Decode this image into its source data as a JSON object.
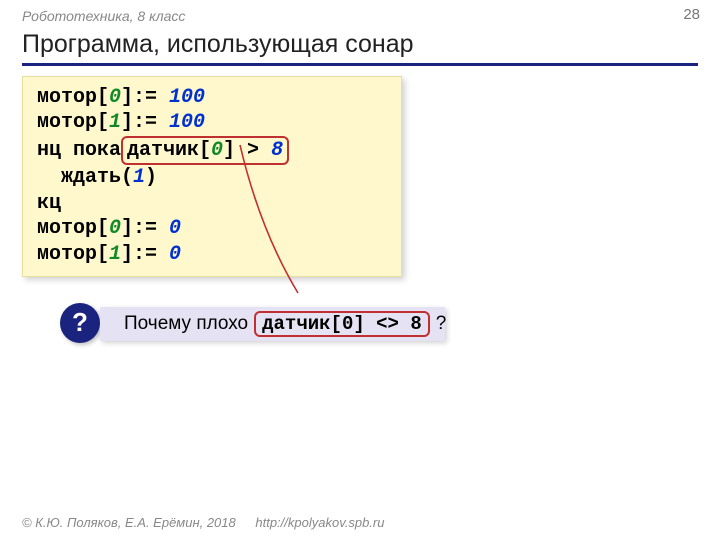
{
  "header": {
    "course": "Робототехника, 8 класс",
    "page": "28",
    "title": "Программа, использующая сонар"
  },
  "code": {
    "l1_a": "мотор[",
    "l1_idx": "0",
    "l1_b": "]:= ",
    "l1_val": "100",
    "l2_a": "мотор[",
    "l2_idx": "1",
    "l2_b": "]:= ",
    "l2_val": "100",
    "l3_a": "нц пока",
    "l3_hl_a": " датчик[",
    "l3_hl_idx": "0",
    "l3_hl_b": "] > ",
    "l3_hl_val": "8",
    "l3_hl_sp": " ",
    "l4_a": "  ждать(",
    "l4_val": "1",
    "l4_b": ")",
    "l5": "кц",
    "l6_a": "мотор[",
    "l6_idx": "0",
    "l6_b": "]:= ",
    "l6_val": "0",
    "l7_a": "мотор[",
    "l7_idx": "1",
    "l7_b": "]:= ",
    "l7_val": "0"
  },
  "question": {
    "mark": "?",
    "prefix": "Почему плохо",
    "hl": "датчик[0] <> 8",
    "suffix": "?"
  },
  "footer": {
    "copyright": "© К.Ю. Поляков, Е.А. Ерёмин, 2018",
    "url": "http://kpolyakov.spb.ru"
  }
}
